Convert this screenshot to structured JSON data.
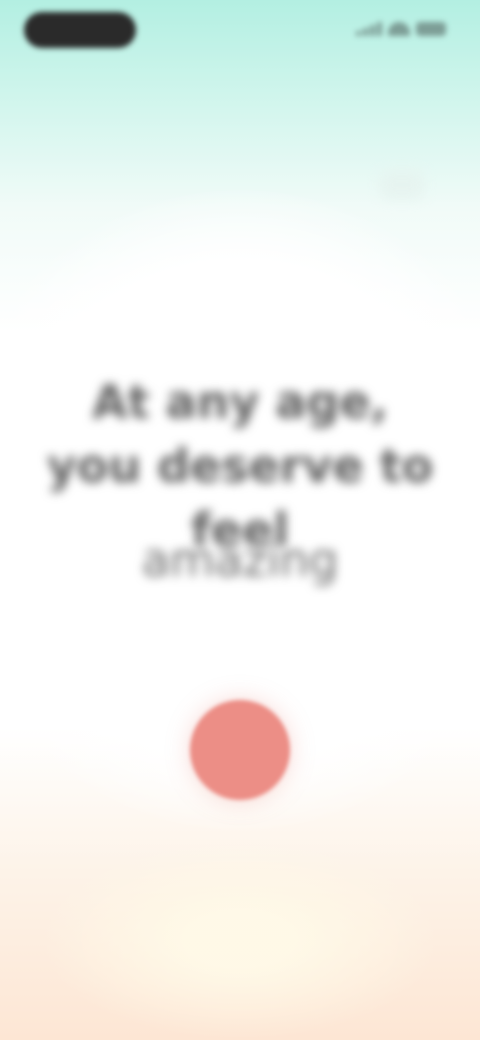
{
  "status_bar": {
    "time_pill": "",
    "signal_icon": "signal-icon",
    "wifi_icon": "wifi-icon",
    "battery_icon": "battery-icon"
  },
  "prompt": {
    "headline": "At any age, you deserve to feel",
    "highlight": "amazing"
  },
  "record": {
    "icon": "record-icon",
    "color": "#ec8e86"
  },
  "footer": {
    "link_label": ""
  },
  "colors": {
    "top_gradient": "#b3efe2",
    "bottom_gradient": "#fde6d4",
    "text": "#5f5f5f"
  }
}
